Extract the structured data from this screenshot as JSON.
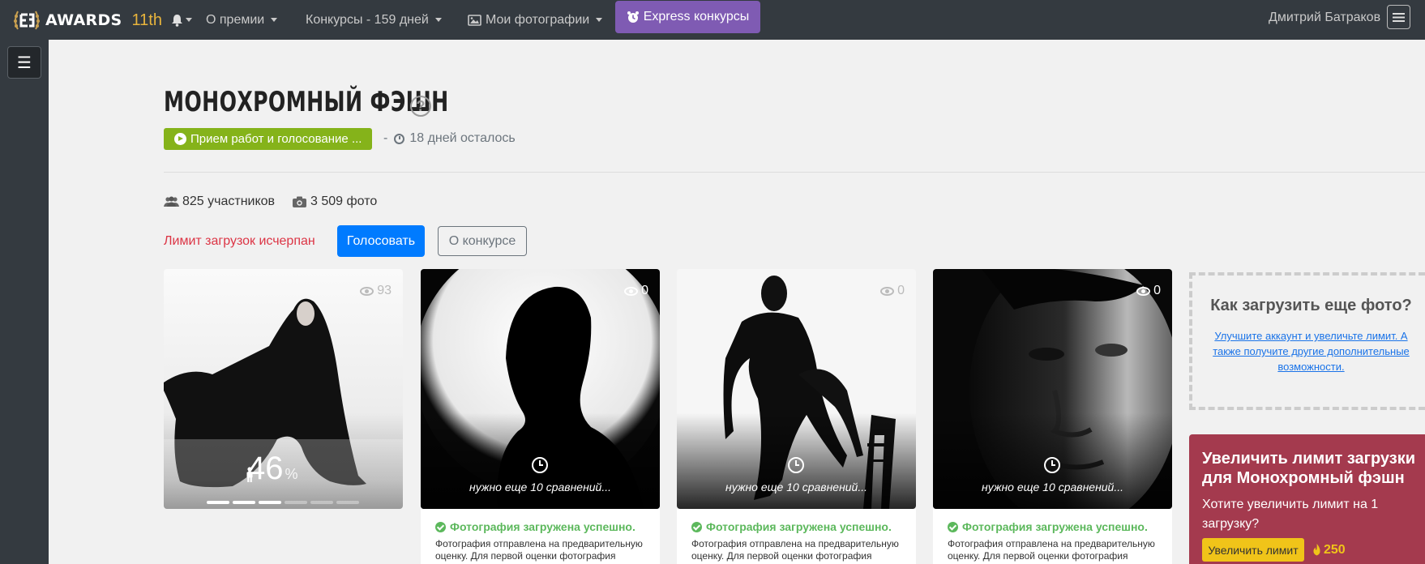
{
  "navbar": {
    "logo_text": "AWARDS",
    "logo_number": "11th",
    "menu": [
      {
        "label": "О премии"
      },
      {
        "label": "Конкурсы - 159 дней"
      },
      {
        "label": "Мои фотографии"
      }
    ],
    "express_label": "Express конкурсы",
    "user_name": "Дмитрий Батраков"
  },
  "sidebar": {
    "toggle_glyph": "☰"
  },
  "contest": {
    "title": "МОНОХРОМНЫЙ ФЭШН",
    "help_glyph": "?",
    "status": "Прием работ и голосование ...",
    "days_prefix": "-",
    "days_left": "18 дней осталось",
    "participants": "825 участников",
    "photos": "3 509 фото",
    "limit_message": "Лимит загрузок исчерпан",
    "vote_label": "Голосовать",
    "about_label": "О конкурсе"
  },
  "photos": [
    {
      "views": "93",
      "rating": "46",
      "rating_unit": "%",
      "progress_filled": 3,
      "progress_total": 6
    },
    {
      "views": "0",
      "pending_text": "нужно еще 10 сравнений...",
      "success": "Фотография загружена успешно.",
      "info": "Фотография отправлена на предварительную оценку. Для первой оценки фотография"
    },
    {
      "views": "0",
      "pending_text": "нужно еще 10 сравнений...",
      "success": "Фотография загружена успешно.",
      "info": "Фотография отправлена на предварительную оценку. Для первой оценки фотография"
    },
    {
      "views": "0",
      "pending_text": "нужно еще 10 сравнений...",
      "success": "Фотография загружена успешно.",
      "info": "Фотография отправлена на предварительную оценку. Для первой оценки фотография"
    }
  ],
  "upload_help": {
    "question": "Как загрузить еще фото?",
    "link": "Улучшите аккаунт и увеличьте лимит. А также получите другие дополнительные возможности."
  },
  "promo": {
    "heading": "Увеличить лимит загрузки для Монохромный фэшн",
    "text": "Хотите увеличить лимит на 1 загрузку?",
    "button": "Увеличить лимит",
    "price": "250"
  },
  "colors": {
    "navbar_bg": "#343a40",
    "express": "#7f5bb3",
    "status_green": "#85b31a",
    "vote_blue": "#007bff",
    "limit_red": "#dc3545",
    "promo_bg": "#a43a4e",
    "promo_btn": "#f0c419"
  }
}
